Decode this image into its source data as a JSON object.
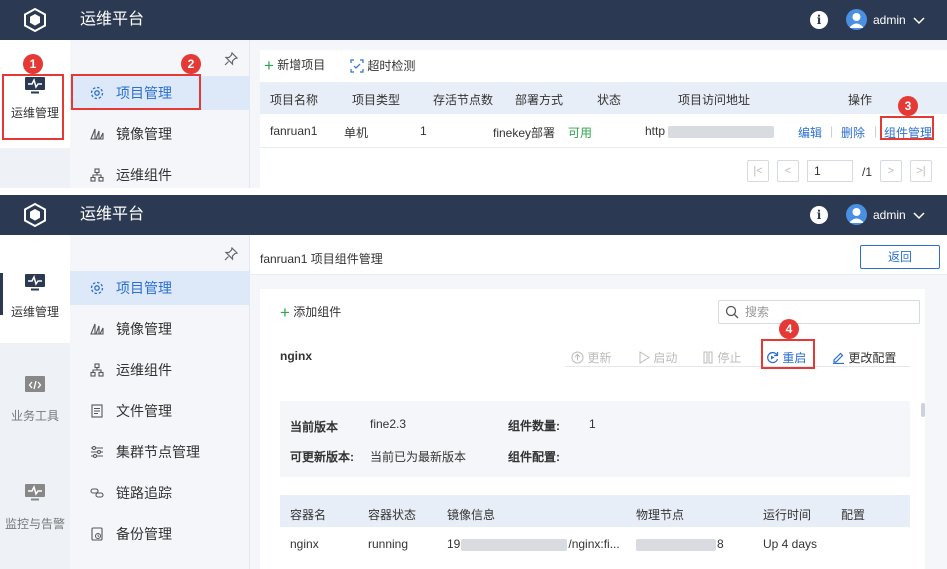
{
  "app": {
    "title": "运维平台",
    "user": "admin"
  },
  "leftnav": [
    {
      "label": "运维管理"
    },
    {
      "label": "业务工具"
    },
    {
      "label": "监控与告警"
    }
  ],
  "subnav_top": [
    "项目管理",
    "镜像管理",
    "运维组件"
  ],
  "subnav_bottom": [
    "项目管理",
    "镜像管理",
    "运维组件",
    "文件管理",
    "集群节点管理",
    "链路追踪",
    "备份管理"
  ],
  "project_list": {
    "toolbar": {
      "new_project": "新增项目",
      "timeout_check": "超时检测"
    },
    "headers": [
      "项目名称",
      "项目类型",
      "存活节点数",
      "部署方式",
      "状态",
      "项目访问地址",
      "操作"
    ],
    "row": {
      "name": "fanruan1",
      "type": "单机",
      "alive_nodes": "1",
      "deploy": "finekey部署",
      "status": "可用",
      "url": "http",
      "actions": {
        "edit": "编辑",
        "delete": "删除",
        "components": "组件管理"
      }
    },
    "pager": {
      "page": "1",
      "total": "/1"
    }
  },
  "component_page": {
    "title": "fanruan1 项目组件管理",
    "return": "返回",
    "add_component": "添加组件",
    "search_placeholder": "搜索",
    "component_name": "nginx",
    "actions": {
      "update": "更新",
      "start": "启动",
      "stop": "停止",
      "restart": "重启",
      "change_config": "更改配置"
    },
    "info": {
      "current_version_label": "当前版本",
      "current_version": "fine2.3",
      "count_label": "组件数量:",
      "count": "1",
      "updatable_label": "可更新版本:",
      "updatable": "当前已为最新版本",
      "config_label": "组件配置:"
    },
    "container_headers": [
      "容器名",
      "容器状态",
      "镜像信息",
      "物理节点",
      "运行时间",
      "配置"
    ],
    "container_row": {
      "name": "nginx",
      "status": "running",
      "image_prefix": "19",
      "image_suffix": "/nginx:fi...",
      "node_suffix": "8",
      "uptime": "Up 4 days"
    }
  },
  "step_badges": [
    "1",
    "2",
    "3",
    "4"
  ],
  "colors": {
    "topbar": "#2b3a52",
    "accent": "#2c6fd1",
    "highlight": "#e53935",
    "available": "#2ea44f"
  }
}
